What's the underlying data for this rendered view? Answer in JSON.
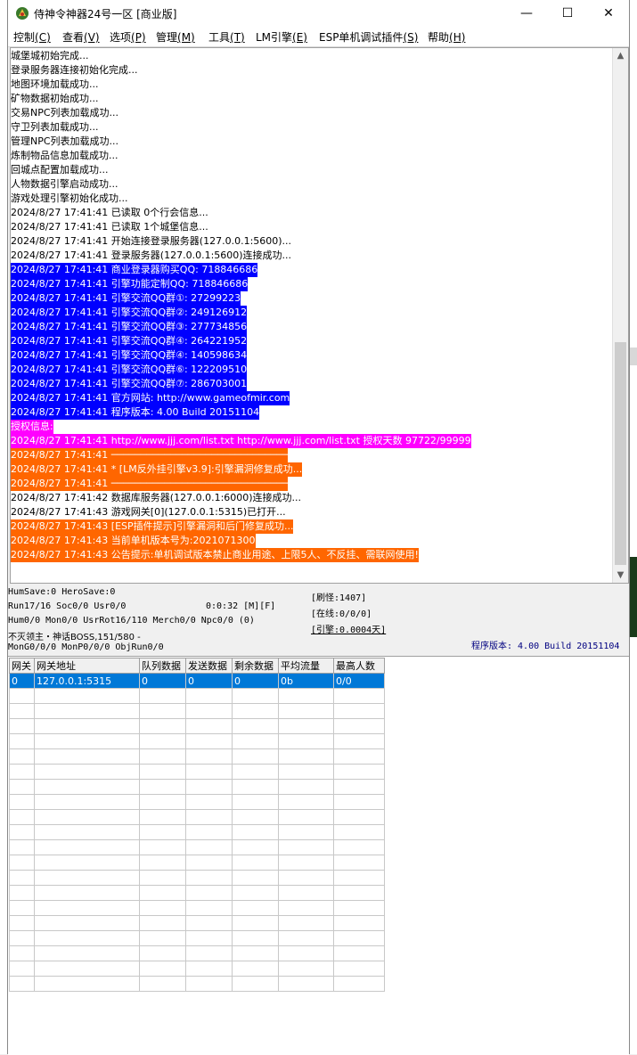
{
  "window": {
    "title": "侍神令神器24号一区 [商业版]",
    "controls": {
      "minimize": "—",
      "maximize": "☐",
      "close": "✕"
    }
  },
  "menu": [
    {
      "label": "控制",
      "key": "(C)"
    },
    {
      "label": "查看",
      "key": "(V)"
    },
    {
      "label": "选项",
      "key": "(P)"
    },
    {
      "label": "管理",
      "key": "(M)"
    },
    {
      "label": "工具",
      "key": "(T)"
    },
    {
      "label": "LM引擎",
      "key": "(E)"
    },
    {
      "label": "ESP单机调试插件",
      "key": "(S)"
    },
    {
      "label": "帮助",
      "key": "(H)"
    }
  ],
  "log": [
    {
      "text": "城堡城初始完成...",
      "style": ""
    },
    {
      "text": "登录服务器连接初始化完成...",
      "style": ""
    },
    {
      "text": "地图环境加载成功...",
      "style": ""
    },
    {
      "text": "矿物数据初始成功...",
      "style": ""
    },
    {
      "text": "交易NPC列表加载成功...",
      "style": ""
    },
    {
      "text": "守卫列表加载成功...",
      "style": ""
    },
    {
      "text": "管理NPC列表加载成功...",
      "style": ""
    },
    {
      "text": "炼制物品信息加载成功...",
      "style": ""
    },
    {
      "text": "回城点配置加载成功...",
      "style": ""
    },
    {
      "text": "人物数据引擎启动成功...",
      "style": ""
    },
    {
      "text": "游戏处理引擎初始化成功...",
      "style": ""
    },
    {
      "text": "2024/8/27 17:41:41 已读取 0个行会信息...",
      "style": ""
    },
    {
      "text": "2024/8/27 17:41:41 已读取 1个城堡信息...",
      "style": ""
    },
    {
      "text": "2024/8/27 17:41:41 开始连接登录服务器(127.0.0.1:5600)...",
      "style": ""
    },
    {
      "text": "2024/8/27 17:41:41 登录服务器(127.0.0.1:5600)连接成功...",
      "style": ""
    },
    {
      "text": "2024/8/27 17:41:41 商业登录器购买QQ: 718846686",
      "style": "blue"
    },
    {
      "text": "2024/8/27 17:41:41 引擎功能定制QQ: 718846686",
      "style": "blue"
    },
    {
      "text": "2024/8/27 17:41:41 引擎交流QQ群①: 27299223",
      "style": "blue"
    },
    {
      "text": "2024/8/27 17:41:41 引擎交流QQ群②: 249126912",
      "style": "blue"
    },
    {
      "text": "2024/8/27 17:41:41 引擎交流QQ群③: 277734856",
      "style": "blue"
    },
    {
      "text": "2024/8/27 17:41:41 引擎交流QQ群④: 264221952",
      "style": "blue"
    },
    {
      "text": "2024/8/27 17:41:41 引擎交流QQ群④: 140598634",
      "style": "blue"
    },
    {
      "text": "2024/8/27 17:41:41 引擎交流QQ群⑥: 122209510",
      "style": "blue"
    },
    {
      "text": "2024/8/27 17:41:41 引擎交流QQ群⑦: 286703001",
      "style": "blue"
    },
    {
      "text": "2024/8/27 17:41:41 官方网站: http://www.gameofmir.com",
      "style": "blue"
    },
    {
      "text": "2024/8/27 17:41:41 程序版本: 4.00 Build 20151104",
      "style": "blue"
    },
    {
      "text": "授权信息:",
      "style": "magenta"
    },
    {
      "text": "2024/8/27 17:41:41 http://www.jjj.com/list.txt http://www.jjj.com/list.txt 授权天数 97722/99999",
      "style": "magenta"
    },
    {
      "text": "2024/8/27 17:41:41 ──────────────────────────────",
      "style": "orange"
    },
    {
      "text": "2024/8/27 17:41:41 * [LM反外挂引擎v3.9]:引擎漏洞修复成功...",
      "style": "orange"
    },
    {
      "text": "2024/8/27 17:41:41 ──────────────────────────────",
      "style": "orange"
    },
    {
      "text": "2024/8/27 17:41:42 数据库服务器(127.0.0.1:6000)连接成功...",
      "style": ""
    },
    {
      "text": "2024/8/27 17:41:43 游戏网关[0](127.0.0.1:5315)已打开...",
      "style": ""
    },
    {
      "text": "2024/8/27 17:41:43 [ESP插件提示]引擎漏洞和后门修复成功...",
      "style": "orange"
    },
    {
      "text": "2024/8/27 17:41:43 当前单机版本号为:2021071300",
      "style": "orange"
    },
    {
      "text": "2024/8/27 17:41:43 公告提示:单机调试版本禁止商业用途、上限5人、不反挂、需联网使用!",
      "style": "orange"
    }
  ],
  "status": {
    "line1": "HumSave:0 HeroSave:0",
    "line2": "Run17/16 Soc0/0 Usr0/0",
    "timer": "0:0:32 [M][F]",
    "line3": "Hum0/0 Mon0/0 UsrRot16/110 Merch0/0 Npc0/0 (0)",
    "line4": "不灭领主・神话BOSS,151/580 -",
    "line5": "MonG0/0/0 MonP0/0/0 ObjRun0/0",
    "refresh": "[刷怪:1407]",
    "online": "[在线:0/0/0]",
    "engine": "[引擎:0.0004天]",
    "version": "程序版本: 4.00 Build 20151104"
  },
  "gateway": {
    "columns": [
      "网关",
      "网关地址",
      "队列数据",
      "发送数据",
      "剩余数据",
      "平均流量",
      "最高人数"
    ],
    "rows": [
      [
        "0",
        "127.0.0.1:5315",
        "0",
        "0",
        "0",
        "0b",
        "0/0"
      ]
    ],
    "empty_rows": 20
  },
  "colors": {
    "highlight_blue": "#0000ff",
    "highlight_magenta": "#ff00ff",
    "highlight_orange": "#ff6600",
    "selection": "#0078d7"
  }
}
